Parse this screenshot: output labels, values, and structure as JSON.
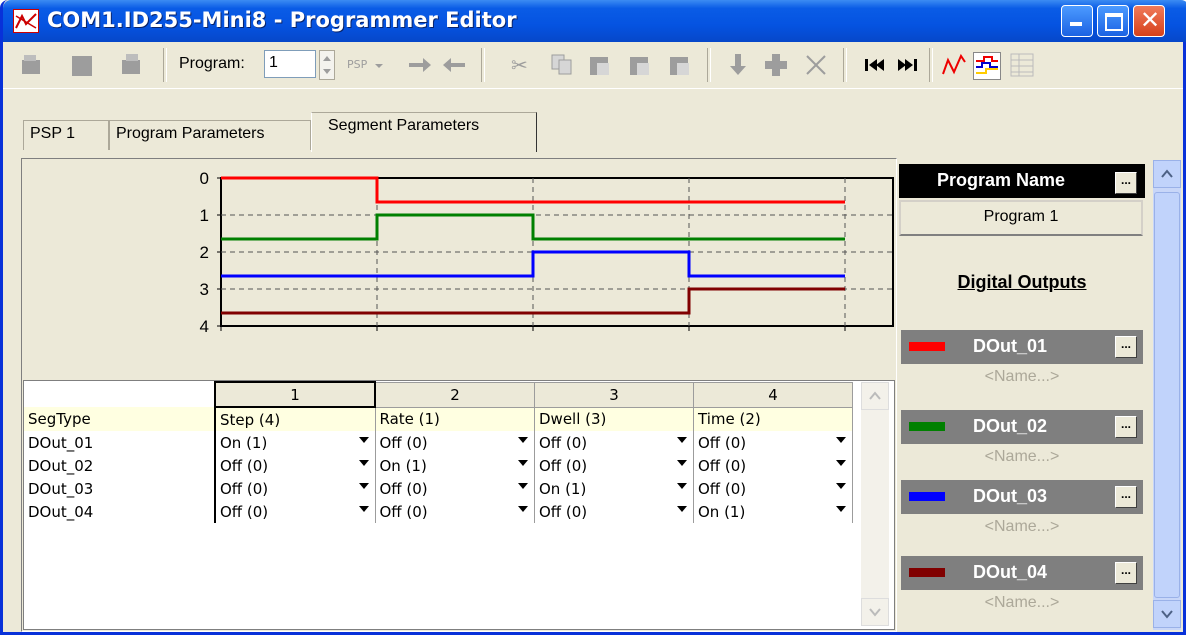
{
  "window": {
    "title": "COM1.ID255-Mini8 - Programmer Editor",
    "icon": "program-editor-icon"
  },
  "toolbar": {
    "program_label": "Program:",
    "program_value": "1"
  },
  "tabs": [
    {
      "label": "PSP 1"
    },
    {
      "label": "Program Parameters"
    },
    {
      "label": "Segment Parameters",
      "active": true
    }
  ],
  "chart": {
    "y_ticks": [
      "0",
      "1",
      "2",
      "3",
      "4"
    ],
    "series": [
      {
        "name": "DOut_01",
        "color": "#ff0000",
        "states": [
          1,
          0,
          0,
          0
        ]
      },
      {
        "name": "DOut_02",
        "color": "#008000",
        "states": [
          0,
          1,
          0,
          0
        ]
      },
      {
        "name": "DOut_03",
        "color": "#0000ff",
        "states": [
          0,
          0,
          1,
          0
        ]
      },
      {
        "name": "DOut_04",
        "color": "#800000",
        "states": [
          0,
          0,
          0,
          1
        ]
      }
    ]
  },
  "grid": {
    "columns": [
      "1",
      "2",
      "3",
      "4"
    ],
    "seg_label": "SegType",
    "seg_types": [
      "Step (4)",
      "Rate (1)",
      "Dwell (3)",
      "Time (2)"
    ],
    "rows": [
      {
        "label": "DOut_01",
        "values": [
          "On (1)",
          "Off (0)",
          "Off (0)",
          "Off (0)"
        ]
      },
      {
        "label": "DOut_02",
        "values": [
          "Off (0)",
          "On (1)",
          "Off (0)",
          "Off (0)"
        ]
      },
      {
        "label": "DOut_03",
        "values": [
          "Off (0)",
          "Off (0)",
          "On (1)",
          "Off (0)"
        ]
      },
      {
        "label": "DOut_04",
        "values": [
          "Off (0)",
          "Off (0)",
          "Off (0)",
          "On (1)"
        ]
      }
    ]
  },
  "side": {
    "program_name_label": "Program Name",
    "program_name_value": "Program 1",
    "digital_outputs_label": "Digital Outputs",
    "outputs": [
      {
        "label": "DOut_01",
        "color": "#ff0000",
        "name_placeholder": "<Name...>"
      },
      {
        "label": "DOut_02",
        "color": "#008000",
        "name_placeholder": "<Name...>"
      },
      {
        "label": "DOut_03",
        "color": "#0000ff",
        "name_placeholder": "<Name...>"
      },
      {
        "label": "DOut_04",
        "color": "#800000",
        "name_placeholder": "<Name...>"
      }
    ],
    "edit_button_label": "..."
  }
}
